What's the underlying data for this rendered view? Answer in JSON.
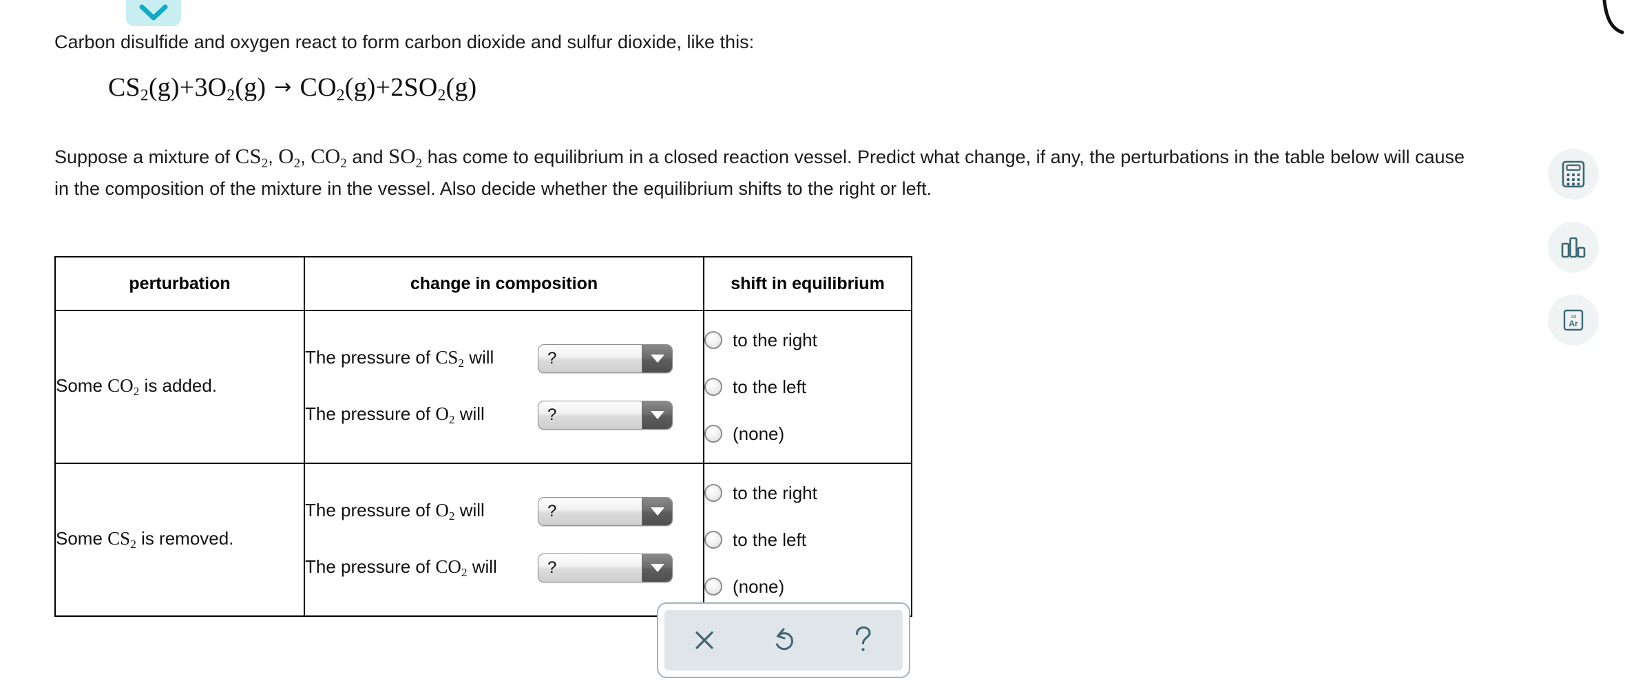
{
  "top": {
    "collapse_icon": "chevron-down-icon",
    "collapse_color": "#18a7c4",
    "collapse_bg": "#c9eef2"
  },
  "intro": {
    "line1": "Carbon disulfide and oxygen react to form carbon dioxide and sulfur dioxide, like this:"
  },
  "equation": {
    "reactant1": "CS",
    "reactant1_sub": "2",
    "reactant1_state": "(g)",
    "plus1": "+",
    "coef2": "3",
    "reactant2": "O",
    "reactant2_sub": "2",
    "reactant2_state": "(g)",
    "arrow": "→",
    "product1": "CO",
    "product1_sub": "2",
    "product1_state": "(g)",
    "plus2": "+",
    "coef3": "2",
    "product2": "SO",
    "product2_sub": "2",
    "product2_state": "(g)"
  },
  "paragraph": {
    "p1": "Suppose a mixture of ",
    "chem1": "CS",
    "chem1_sub": "2",
    "p2": ", ",
    "chem2": "O",
    "chem2_sub": "2",
    "p3": ", ",
    "chem3": "CO",
    "chem3_sub": "2",
    "p4": " and ",
    "chem4": "SO",
    "chem4_sub": "2",
    "p5": " has come to equilibrium in a closed reaction vessel. Predict what change, if any, the perturbations in the table below will cause in the composition of the mixture in the vessel. Also decide whether the equilibrium shifts to the right or left."
  },
  "table": {
    "headers": {
      "perturbation": "perturbation",
      "change": "change in composition",
      "shift": "shift in equilibrium"
    },
    "rows": [
      {
        "perturbation_prefix": "Some ",
        "perturbation_chem": "CO",
        "perturbation_sub": "2",
        "perturbation_suffix": " is added.",
        "changes": [
          {
            "label_prefix": "The pressure of ",
            "chem": "CS",
            "sub": "2",
            "label_suffix": " will",
            "select_value": "?"
          },
          {
            "label_prefix": "The pressure of ",
            "chem": "O",
            "sub": "2",
            "label_suffix": " will",
            "select_value": "?"
          }
        ],
        "shift_options": [
          "to the right",
          "to the left",
          "(none)"
        ],
        "shift_selected": null
      },
      {
        "perturbation_prefix": "Some ",
        "perturbation_chem": "CS",
        "perturbation_sub": "2",
        "perturbation_suffix": " is removed.",
        "changes": [
          {
            "label_prefix": "The pressure of ",
            "chem": "O",
            "sub": "2",
            "label_suffix": " will",
            "select_value": "?"
          },
          {
            "label_prefix": "The pressure of ",
            "chem": "CO",
            "sub": "2",
            "label_suffix": " will",
            "select_value": "?"
          }
        ],
        "shift_options": [
          "to the right",
          "to the left",
          "(none)"
        ],
        "shift_selected": null
      }
    ]
  },
  "rail": {
    "buttons": [
      {
        "icon": "calculator-icon",
        "label": "Calculator"
      },
      {
        "icon": "bar-chart-icon",
        "label": "Data"
      },
      {
        "icon": "periodic-table-element-icon",
        "label": "Periodic Table",
        "element_number": "18",
        "element_symbol": "Ar"
      }
    ],
    "icon_color": "#3d6673",
    "bg_color": "#f0f3f4"
  },
  "actionbar": {
    "buttons": [
      {
        "icon": "close-x-icon",
        "label": "Clear"
      },
      {
        "icon": "undo-arrow-icon",
        "label": "Undo"
      },
      {
        "icon": "question-mark-icon",
        "label": "Help"
      }
    ],
    "icon_color": "#3d6673",
    "bg_color": "#dfe5e8"
  }
}
